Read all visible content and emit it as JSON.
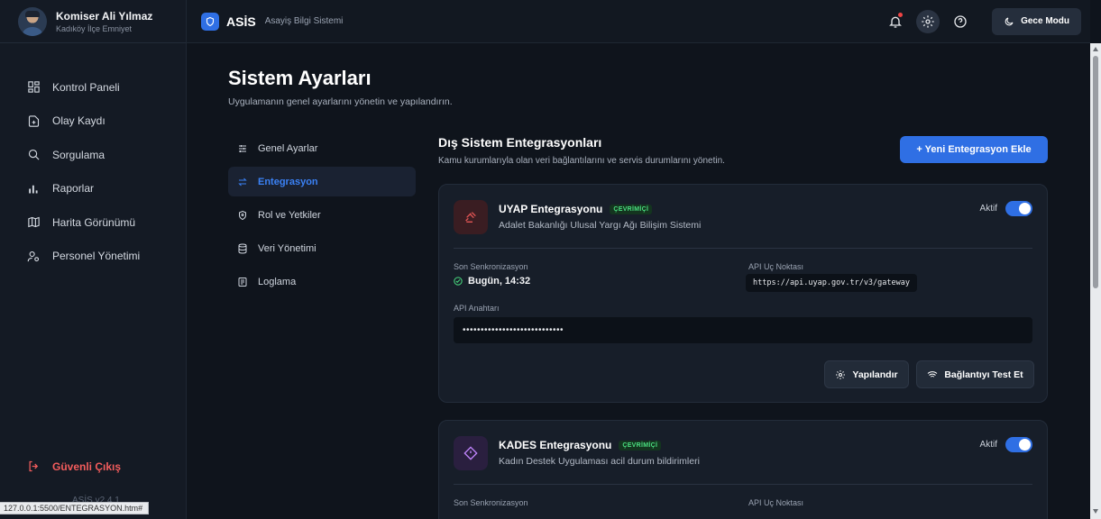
{
  "profile": {
    "name": "Komiser Ali Yılmaz",
    "unit": "Kadıköy İlçe Emniyet"
  },
  "sidebar": {
    "items": [
      {
        "label": "Kontrol Paneli",
        "icon": "dashboard-icon"
      },
      {
        "label": "Olay Kaydı",
        "icon": "file-plus-icon"
      },
      {
        "label": "Sorgulama",
        "icon": "search-icon"
      },
      {
        "label": "Raporlar",
        "icon": "bar-chart-icon"
      },
      {
        "label": "Harita Görünümü",
        "icon": "map-icon"
      },
      {
        "label": "Personel Yönetimi",
        "icon": "users-icon"
      }
    ],
    "logout": "Güvenli Çıkış",
    "version": "ASİS v2.4.1"
  },
  "statusbar": {
    "url": "127.0.0.1:5500/ENTEGRASYON.htm#"
  },
  "topbar": {
    "brand": "ASİS",
    "brand_sub": "Asayiş Bilgi Sistemi",
    "night_mode": "Gece Modu"
  },
  "page": {
    "title": "Sistem Ayarları",
    "subtitle": "Uygulamanın genel ayarlarını yönetin ve yapılandırın."
  },
  "settings_menu": [
    {
      "label": "Genel Ayarlar",
      "icon": "sliders-icon",
      "active": false
    },
    {
      "label": "Entegrasyon",
      "icon": "arrows-swap-icon",
      "active": true
    },
    {
      "label": "Rol ve Yetkiler",
      "icon": "shield-icon",
      "active": false
    },
    {
      "label": "Veri Yönetimi",
      "icon": "database-icon",
      "active": false
    },
    {
      "label": "Loglama",
      "icon": "log-icon",
      "active": false
    }
  ],
  "content": {
    "title": "Dış Sistem Entegrasyonları",
    "subtitle": "Kamu kurumlarıyla olan veri bağlantılarını ve servis durumlarını yönetin.",
    "add_button": "+  Yeni Entegrasyon Ekle"
  },
  "integrations": [
    {
      "name": "UYAP Entegrasyonu",
      "status": "ÇEVRİMİÇİ",
      "description": "Adalet Bakanlığı Ulusal Yargı Ağı Bilişim Sistemi",
      "toggle_label": "Aktif",
      "enabled": true,
      "last_sync_label": "Son Senkronizasyon",
      "last_sync": "Bugün, 14:32",
      "endpoint_label": "API Uç Noktası",
      "endpoint": "https://api.uyap.gov.tr/v3/gateway",
      "key_label": "API Anahtarı",
      "key": "••••••••••••••••••••••••••••",
      "configure_button": "Yapılandır",
      "test_button": "Bağlantıyı Test Et",
      "icon": "gavel-icon",
      "accent": "#e25555"
    },
    {
      "name": "KADES Entegrasyonu",
      "status": "ÇEVRİMİÇİ",
      "description": "Kadın Destek Uygulaması acil durum bildirimleri",
      "toggle_label": "Aktif",
      "enabled": true,
      "last_sync_label": "Son Senkronizasyon",
      "endpoint_label": "API Uç Noktası",
      "icon": "diamond-alert-icon",
      "accent": "#a855f7"
    }
  ],
  "colors": {
    "accent": "#2f6fe4",
    "online": "#4ade80",
    "danger": "#f25c5c"
  }
}
